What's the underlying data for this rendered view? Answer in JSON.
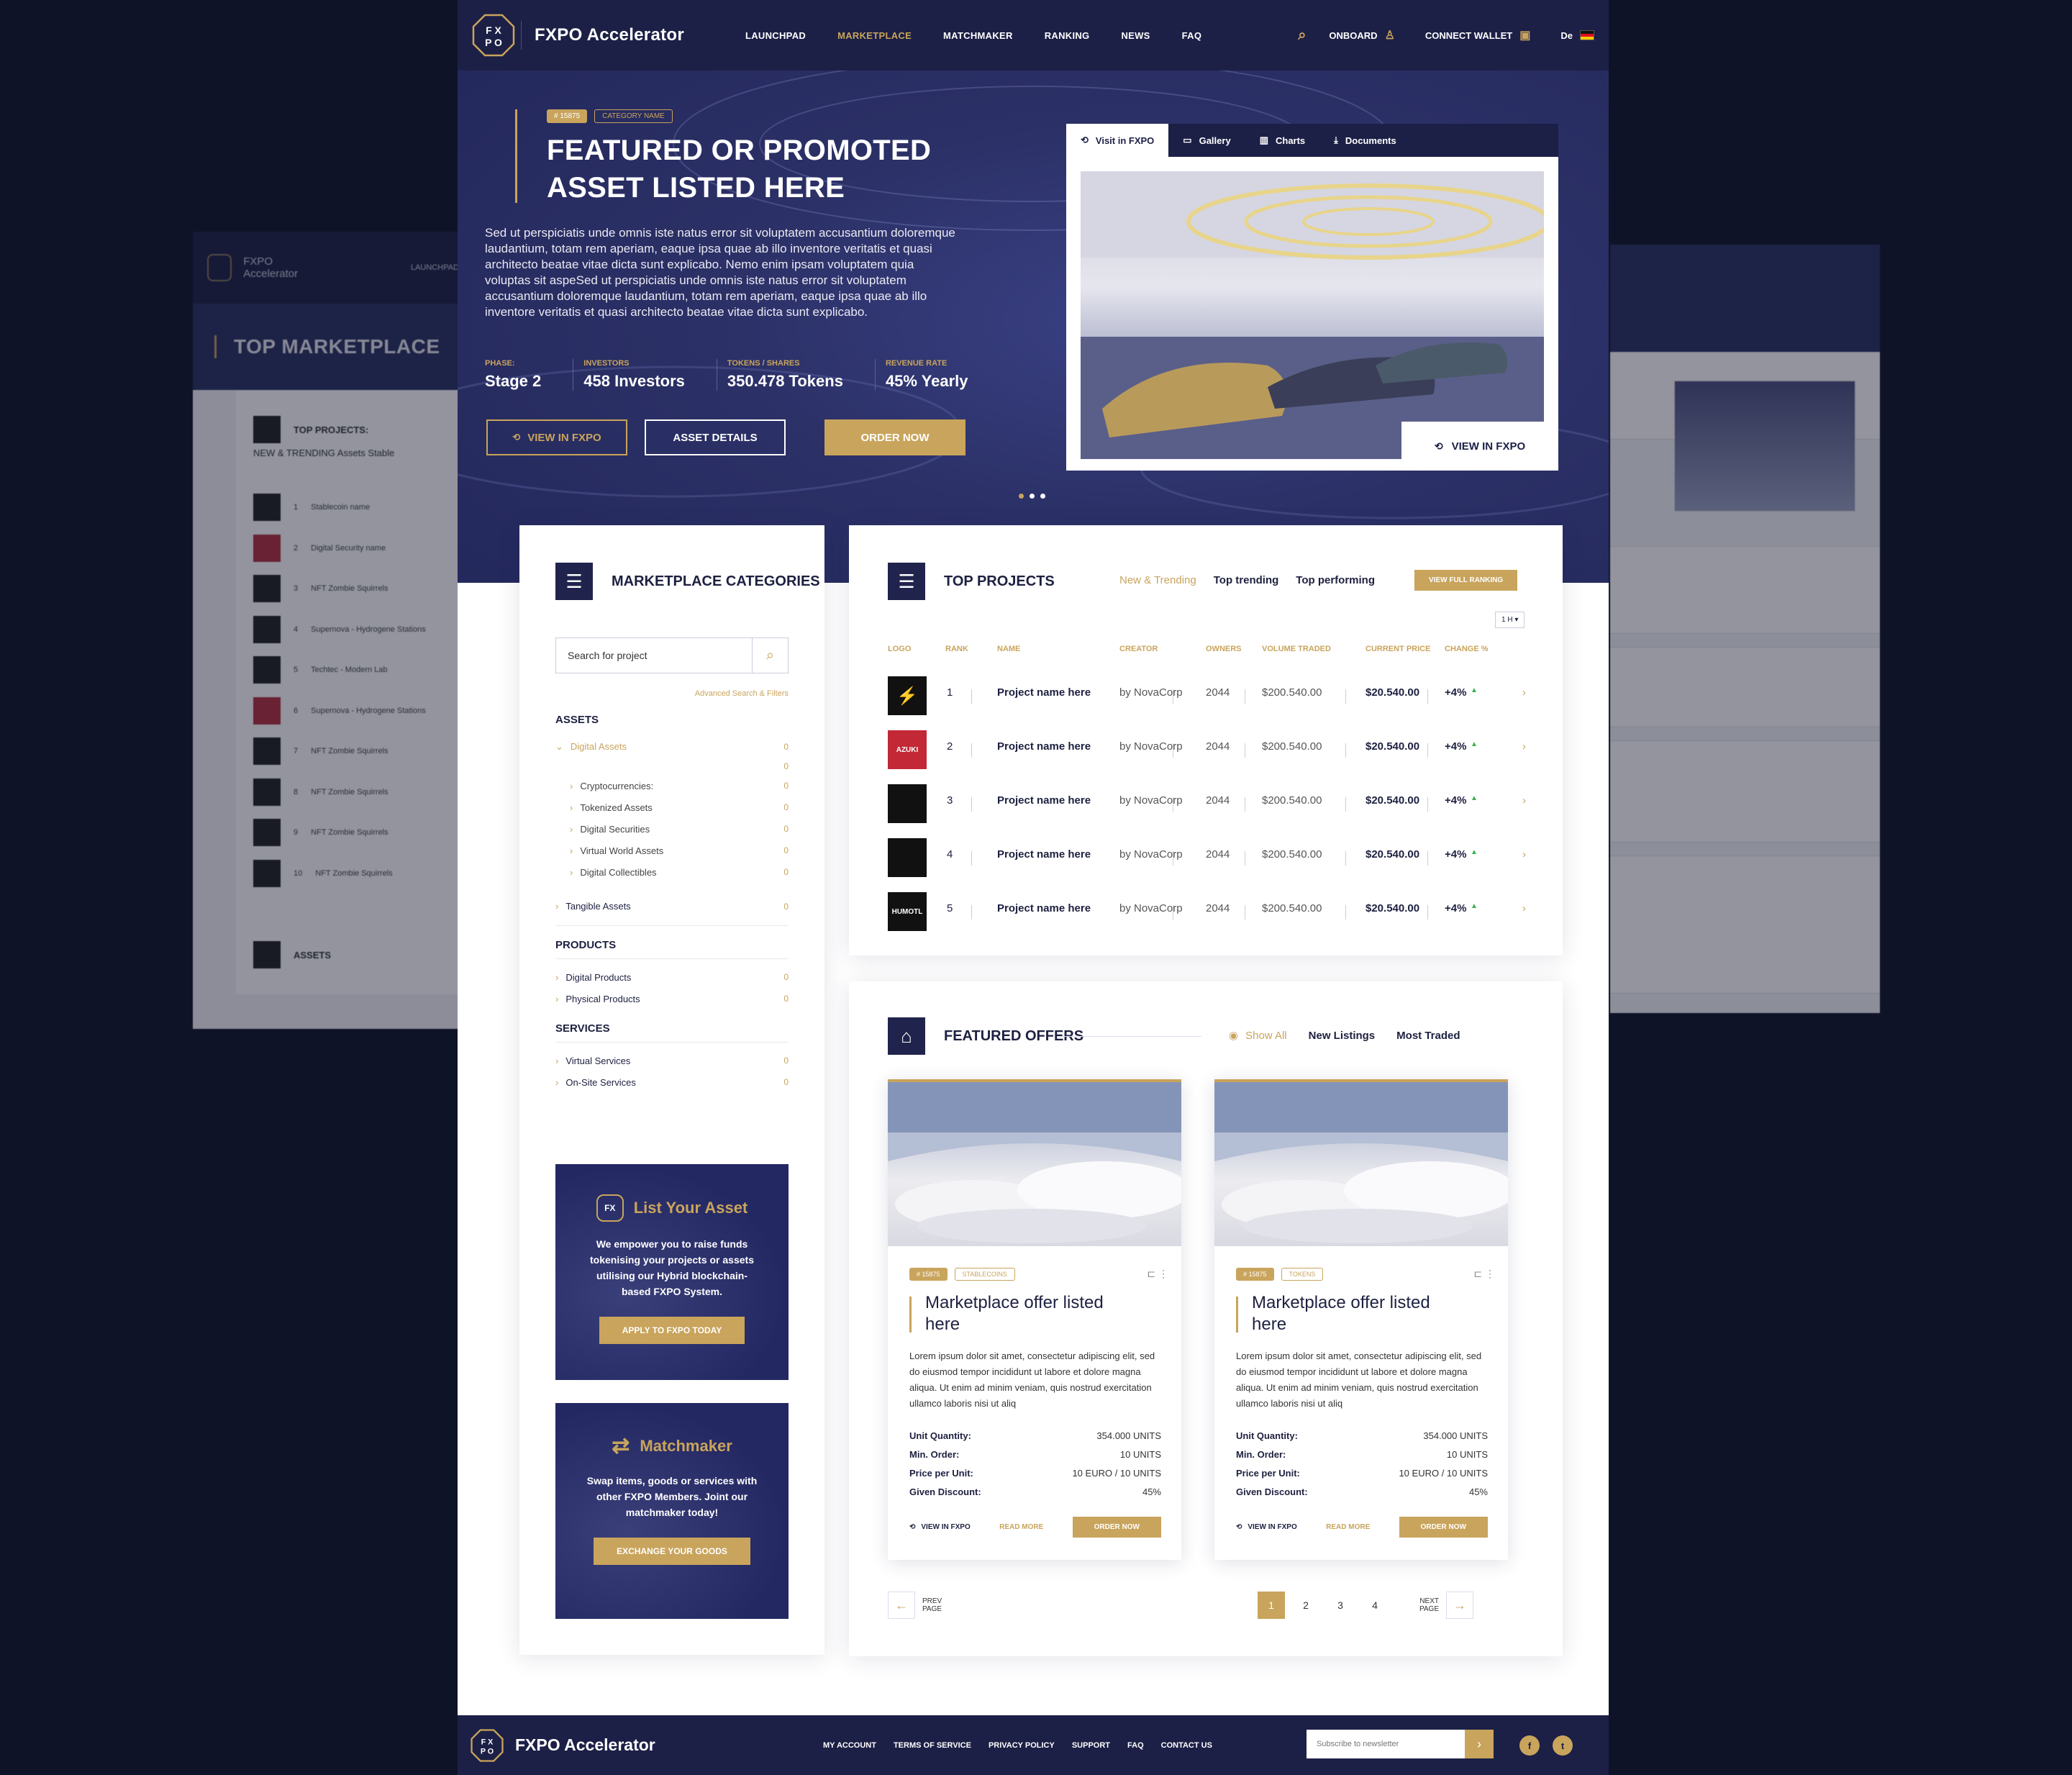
{
  "ghost_left": {
    "brand": "FXPO Accelerator",
    "nav": "LAUNCHPAD",
    "hero_title": "TOP MARKETPLACE",
    "top_projects": "TOP PROJECTS:",
    "tabs": "NEW & TRENDING    Assets    Stable",
    "rows": [
      "Stablecoin name",
      "Digital Security  name",
      "NFT Zombie Squirrels",
      "Supernova - Hydrogene Stations",
      "Techtec - Modern Lab",
      "Supernova - Hydrogene Stations",
      "NFT Zombie Squirrels",
      "NFT Zombie Squirrels",
      "NFT Zombie Squirrels",
      "NFT Zombie Squirrels"
    ],
    "assets": "ASSETS"
  },
  "nav": {
    "brand": "FXPO Accelerator",
    "menu": [
      "LAUNCHPAD",
      "MARKETPLACE",
      "MATCHMAKER",
      "RANKING",
      "NEWS",
      "FAQ"
    ],
    "active": "MARKETPLACE",
    "onboard": "ONBOARD",
    "connect_wallet": "CONNECT WALLET",
    "lang": "De"
  },
  "hero": {
    "tag_id": "# 15875",
    "tag_category": "CATEGORY NAME",
    "title": "FEATURED OR PROMOTED ASSET LISTED HERE",
    "description": "Sed ut perspiciatis unde omnis iste natus error sit voluptatem accusantium doloremque laudantium, totam rem aperiam, eaque ipsa quae ab illo inventore veritatis et quasi architecto beatae vitae dicta sunt explicabo. Nemo enim ipsam voluptatem quia voluptas sit aspeSed ut perspiciatis unde omnis iste natus error sit voluptatem accusantium doloremque laudantium, totam rem aperiam, eaque ipsa quae ab illo inventore veritatis et quasi architecto beatae vitae dicta sunt explicabo.",
    "stats": [
      {
        "label": "PHASE:",
        "value": "Stage 2"
      },
      {
        "label": "INVESTORS",
        "value": "458 Investors"
      },
      {
        "label": "TOKENS / SHARES",
        "value": "350.478 Tokens"
      },
      {
        "label": "REVENUE RATE",
        "value": "45% Yearly"
      }
    ],
    "btn_view": "VIEW IN FXPO",
    "btn_details": "ASSET DETAILS",
    "btn_order": "ORDER NOW",
    "media_tabs": [
      "Visit in FXPO",
      "Gallery",
      "Charts",
      "Documents"
    ],
    "media_cta": "VIEW IN FXPO"
  },
  "categories": {
    "title": "MARKETPLACE CATEGORIES",
    "search_placeholder": "Search for project",
    "advanced": "Advanced Search & Filters",
    "assets_heading": "ASSETS",
    "digital_assets": "Digital Assets",
    "digital_subs": [
      "Cryptocurrencies:",
      "Tokenized Assets",
      "Digital Securities",
      "Virtual World Assets",
      "Digital Collectibles"
    ],
    "tangible": "Tangible Assets",
    "products_heading": "PRODUCTS",
    "products": [
      "Digital Products",
      "Physical Products"
    ],
    "services_heading": "SERVICES",
    "services": [
      "Virtual Services",
      "On-Site Services"
    ],
    "count": "0"
  },
  "promo_list": {
    "title": "List Your Asset",
    "text": "We empower you to raise funds tokenising your projects or assets utilising our Hybrid blockchain-based FXPO System.",
    "button": "APPLY TO FXPO TODAY"
  },
  "promo_match": {
    "title": "Matchmaker",
    "text": "Swap items, goods or services with other FXPO Members. Joint our matchmaker today!",
    "button": "EXCHANGE YOUR GOODS"
  },
  "top_projects": {
    "title": "TOP PROJECTS",
    "tabs": [
      "New & Trending",
      "Top trending",
      "Top performing"
    ],
    "view_full": "VIEW FULL RANKING",
    "timeframe": "1 H ▾",
    "headers": [
      "LOGO",
      "RANK",
      "NAME",
      "CREATOR",
      "OWNERS",
      "VOLUME TRADED",
      "CURRENT PRICE",
      "CHANGE %"
    ],
    "rows": [
      {
        "logo": "",
        "rank": "1",
        "name": "Project name here",
        "creator": "by NovaCorp",
        "owners": "2044",
        "volume": "$200.540.00",
        "price": "$20.540.00",
        "change": "+4%"
      },
      {
        "logo": "AZUKI",
        "rank": "2",
        "name": "Project name here",
        "creator": "by NovaCorp",
        "owners": "2044",
        "volume": "$200.540.00",
        "price": "$20.540.00",
        "change": "+4%"
      },
      {
        "logo": "",
        "rank": "3",
        "name": "Project name here",
        "creator": "by NovaCorp",
        "owners": "2044",
        "volume": "$200.540.00",
        "price": "$20.540.00",
        "change": "+4%"
      },
      {
        "logo": "",
        "rank": "4",
        "name": "Project name here",
        "creator": "by NovaCorp",
        "owners": "2044",
        "volume": "$200.540.00",
        "price": "$20.540.00",
        "change": "+4%"
      },
      {
        "logo": "HUMOTL",
        "rank": "5",
        "name": "Project name here",
        "creator": "by NovaCorp",
        "owners": "2044",
        "volume": "$200.540.00",
        "price": "$20.540.00",
        "change": "+4%"
      }
    ]
  },
  "featured": {
    "title": "FEATURED OFFERS",
    "show_all": "Show All",
    "tabs": [
      "New Listings",
      "Most Traded"
    ],
    "offers": [
      {
        "id": "# 15875",
        "cat": "STABLECOINS",
        "title": "Marketplace offer listed here",
        "desc": "Lorem ipsum dolor sit amet, consectetur adipiscing elit, sed do eiusmod tempor incididunt ut labore et dolore magna aliqua. Ut enim ad minim veniam, quis nostrud exercitation ullamco laboris nisi ut aliq",
        "kv": [
          [
            "Unit Quantity:",
            "354.000 UNITS"
          ],
          [
            "Min. Order:",
            "10 UNITS"
          ],
          [
            "Price per Unit:",
            "10 EURO / 10 UNITS"
          ],
          [
            "Given Discount:",
            "45%"
          ]
        ],
        "view": "VIEW IN FXPO",
        "read": "READ MORE",
        "order": "ORDER NOW"
      },
      {
        "id": "# 15875",
        "cat": "TOKENS",
        "title": "Marketplace offer listed here",
        "desc": "Lorem ipsum dolor sit amet, consectetur adipiscing elit, sed do eiusmod tempor incididunt ut labore et dolore magna aliqua. Ut enim ad minim veniam, quis nostrud exercitation ullamco laboris nisi ut aliq",
        "kv": [
          [
            "Unit Quantity:",
            "354.000 UNITS"
          ],
          [
            "Min. Order:",
            "10 UNITS"
          ],
          [
            "Price per Unit:",
            "10 EURO / 10 UNITS"
          ],
          [
            "Given Discount:",
            "45%"
          ]
        ],
        "view": "VIEW IN FXPO",
        "read": "READ MORE",
        "order": "ORDER NOW"
      }
    ],
    "prev": "PREV PAGE",
    "next": "NEXT PAGE",
    "pages": [
      "1",
      "2",
      "3",
      "4"
    ]
  },
  "footer": {
    "brand": "FXPO Accelerator",
    "links": [
      "MY ACCOUNT",
      "TERMS OF SERVICE",
      "PRIVACY POLICY",
      "SUPPORT",
      "FAQ",
      "CONTACT US"
    ],
    "newsletter_placeholder": "Subscribe to newsletter"
  },
  "colors": {
    "gold": "#c9a45c",
    "navy": "#20244d",
    "dark": "#0f1327"
  }
}
